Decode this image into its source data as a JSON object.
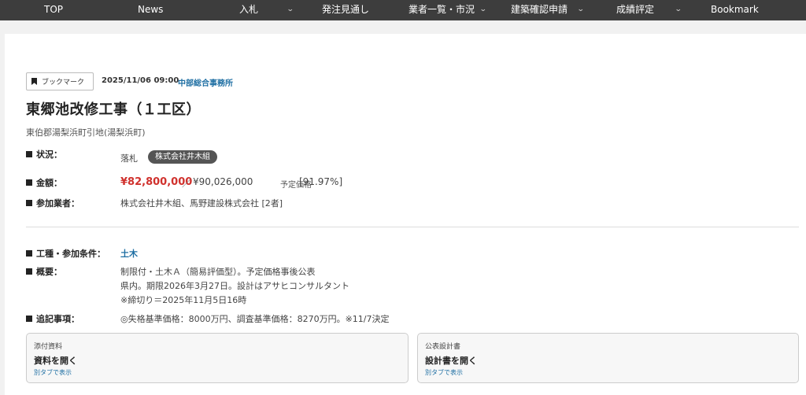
{
  "nav": {
    "items": [
      "TOP",
      "News",
      "入札",
      "発注見通し",
      "業者一覧・市況",
      "建築確認申請",
      "成績評定",
      "Bookmark"
    ],
    "chevron": "⌄"
  },
  "header": {
    "bookmark_label": "ブックマーク",
    "date": "2025/11/06 09:00",
    "office": "中部総合事務所"
  },
  "project": {
    "title": "東郷池改修工事（１工区）",
    "location": "東伯郡湯梨浜町引地(湯梨浜町)"
  },
  "details": {
    "status_label": "状況：",
    "status_value": "落札",
    "winner_badge": "株式会社井木組",
    "amount_label": "金額：",
    "amount_main": "¥82,800,000",
    "amount_sep": "／",
    "amount_estimate": "¥90,026,000",
    "amount_estimate_label": "予定価格",
    "amount_ratio": "[91.97%]",
    "participants_label": "参加業者：",
    "participants_value": "株式会社井木組、馬野建設株式会社 [2者]",
    "type_label": "工種・参加条件：",
    "type_value": "土木",
    "summary_label": "概要：",
    "summary_lines": [
      "制限付・土木Ａ（簡易評価型）。予定価格事後公表",
      "県内。期限2026年3月27日。設計はアサヒコンサルタント",
      "※締切り＝2025年11月5日16時"
    ],
    "notes_label": "追記事項：",
    "notes_value": "◎失格基準価格：8000万円、調査基準価格：8270万円。※11/7決定"
  },
  "documents": [
    {
      "head": "添付資料",
      "title": "資料を開く",
      "sub": "別タブで表示"
    },
    {
      "head": "公表設計書",
      "title": "設計書を開く",
      "sub": "別タブで表示"
    }
  ]
}
